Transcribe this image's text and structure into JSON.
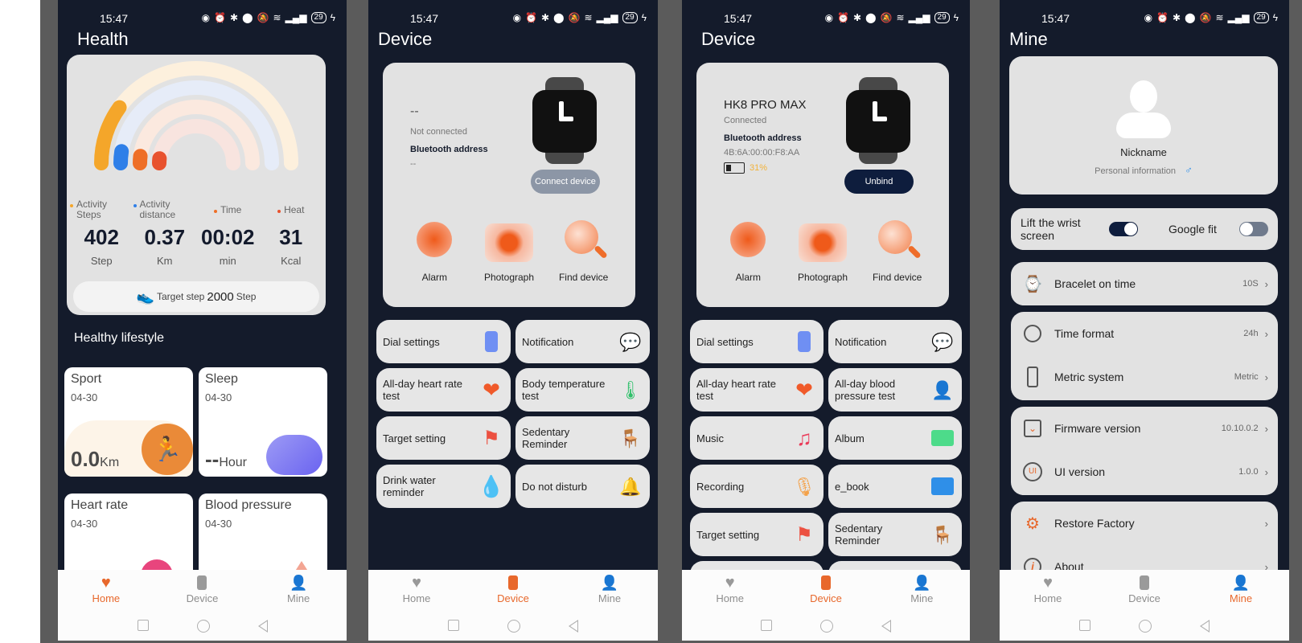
{
  "status_bar": {
    "time": "15:47",
    "battery": "29"
  },
  "navigation": {
    "tabs": [
      "Home",
      "Device",
      "Mine"
    ]
  },
  "health": {
    "title": "Health",
    "stats": [
      {
        "label": "Activity Steps",
        "value": "402",
        "unit": "Step",
        "color": "#f4a62a"
      },
      {
        "label": "Activity distance",
        "value": "0.37",
        "unit": "Km",
        "color": "#2f7fe8"
      },
      {
        "label": "Time",
        "value": "00:02",
        "unit": "min",
        "color": "#ee6e26"
      },
      {
        "label": "Heat",
        "value": "31",
        "unit": "Kcal",
        "color": "#e8522e"
      }
    ],
    "rings_progress": [
      0.2,
      0.05,
      0.04,
      0.04
    ],
    "target": {
      "prefix": "Target step",
      "value": "2000",
      "suffix": "Step"
    },
    "section_title": "Healthy lifestyle",
    "tiles": [
      {
        "title": "Sport",
        "date": "04-30",
        "value": "0.0",
        "unit": "Km"
      },
      {
        "title": "Sleep",
        "date": "04-30",
        "value": "--",
        "unit": "Hour"
      },
      {
        "title": "Heart rate",
        "date": "04-30"
      },
      {
        "title": "Blood pressure",
        "date": "04-30"
      }
    ]
  },
  "device_disconnected": {
    "title": "Device",
    "name": "--",
    "status": "Not connected",
    "bt_label": "Bluetooth address",
    "bt_value": "--",
    "button": "Connect device",
    "quick": [
      "Alarm",
      "Photograph",
      "Find device"
    ],
    "grid": [
      "Dial settings",
      "Notification",
      "All-day heart rate test",
      "Body temperature test",
      "Target setting",
      "Sedentary Reminder",
      "Drink water reminder",
      "Do not disturb"
    ]
  },
  "device_connected": {
    "title": "Device",
    "name": "HK8 PRO MAX",
    "status": "Connected",
    "bt_label": "Bluetooth address",
    "bt_value": "4B:6A:00:00:F8:AA",
    "battery": "31%",
    "button": "Unbind",
    "quick": [
      "Alarm",
      "Photograph",
      "Find device"
    ],
    "grid": [
      "Dial settings",
      "Notification",
      "All-day heart rate test",
      "All-day blood pressure test",
      "Music",
      "Album",
      "Recording",
      "e_book",
      "Target setting",
      "Sedentary Reminder",
      "",
      ""
    ]
  },
  "mine": {
    "title": "Mine",
    "nickname": "Nickname",
    "personal_info": "Personal information",
    "gender_icon": "male",
    "toggles": [
      {
        "label": "Lift the wrist screen",
        "on": true
      },
      {
        "label": "Google fit",
        "on": false
      }
    ],
    "rows": [
      {
        "label": "Bracelet on time",
        "value": "10S"
      },
      {
        "label": "Time format",
        "value": "24h"
      },
      {
        "label": "Metric system",
        "value": "Metric"
      },
      {
        "label": "Firmware version",
        "value": "10.10.0.2"
      },
      {
        "label": "UI version",
        "value": "1.0.0"
      },
      {
        "label": "Restore Factory",
        "value": ""
      },
      {
        "label": "About",
        "value": ""
      }
    ]
  },
  "colors": {
    "accent": "#e8682c",
    "dark": "#141b2b",
    "card": "#e2e2e2",
    "unbind": "#0e1d3d",
    "connect": "#8c96a6"
  }
}
